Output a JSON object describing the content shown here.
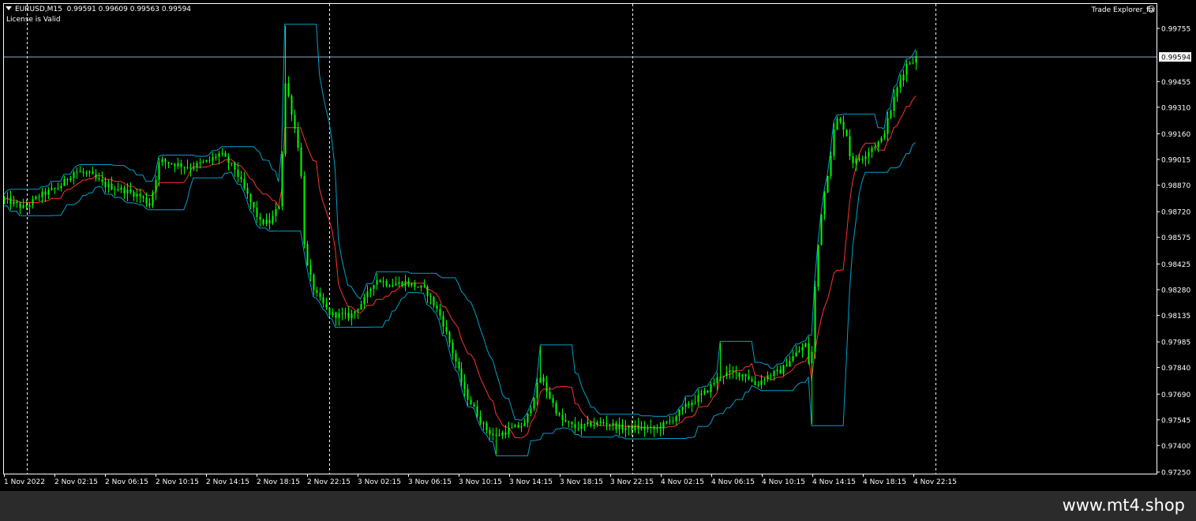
{
  "header": {
    "symbol": "EURUSD,M15",
    "ohlc": "0.99591 0.99609 0.99563 0.99594",
    "license": "License is Valid",
    "indicator": "Trade Explorer_fix",
    "watermark": "www.mt4.shop"
  },
  "colors": {
    "background": "#000000",
    "frame": "#ffffff",
    "candle": "#00ff00",
    "grid": "#ffffff",
    "bid_line": "#8fa8c8",
    "band_upper": "#00a0c8",
    "band_mid": "#ff3030",
    "band_lower": "#00a0c8"
  },
  "chart_data": {
    "type": "candlestick",
    "symbol": "EURUSD",
    "timeframe": "M15",
    "current_price": "0.99594",
    "ylim": [
      0.9725,
      0.9983
    ],
    "y_ticks": [
      "0.99755",
      "0.99594",
      "0.99455",
      "0.99310",
      "0.99160",
      "0.99015",
      "0.98870",
      "0.98720",
      "0.98575",
      "0.98425",
      "0.98280",
      "0.98135",
      "0.97985",
      "0.97840",
      "0.97690",
      "0.97545",
      "0.97400",
      "0.97250"
    ],
    "x_ticks": [
      "1 Nov 2022",
      "2 Nov 02:15",
      "2 Nov 06:15",
      "2 Nov 10:15",
      "2 Nov 14:15",
      "2 Nov 18:15",
      "2 Nov 22:15",
      "3 Nov 02:15",
      "3 Nov 06:15",
      "3 Nov 10:15",
      "3 Nov 14:15",
      "3 Nov 18:15",
      "3 Nov 22:15",
      "4 Nov 02:15",
      "4 Nov 06:15",
      "4 Nov 10:15",
      "4 Nov 14:15",
      "4 Nov 18:15",
      "4 Nov 22:15"
    ],
    "day_separators": [
      "2 Nov 00:00",
      "3 Nov 00:00",
      "4 Nov 00:00",
      "5 Nov 00:00"
    ],
    "close_path": [
      [
        0,
        0.9879
      ],
      [
        4,
        0.9874
      ],
      [
        7,
        0.9881
      ],
      [
        11,
        0.9886
      ],
      [
        14,
        0.9895
      ],
      [
        17,
        0.9893
      ],
      [
        20,
        0.9887
      ],
      [
        24,
        0.9884
      ],
      [
        27,
        0.9881
      ],
      [
        29,
        0.9876
      ],
      [
        31,
        0.9901
      ],
      [
        34,
        0.9899
      ],
      [
        37,
        0.9897
      ],
      [
        41,
        0.9901
      ],
      [
        43,
        0.9905
      ],
      [
        46,
        0.9896
      ],
      [
        49,
        0.9878
      ],
      [
        51,
        0.9866
      ],
      [
        53,
        0.9866
      ],
      [
        55,
        0.9877
      ],
      [
        56,
        0.9945
      ],
      [
        57,
        0.9933
      ],
      [
        59,
        0.9903
      ],
      [
        60,
        0.9845
      ],
      [
        62,
        0.9826
      ],
      [
        65,
        0.9814
      ],
      [
        69,
        0.9813
      ],
      [
        72,
        0.9823
      ],
      [
        74,
        0.9834
      ],
      [
        77,
        0.9831
      ],
      [
        80,
        0.9832
      ],
      [
        84,
        0.9828
      ],
      [
        87,
        0.9813
      ],
      [
        90,
        0.9788
      ],
      [
        92,
        0.977
      ],
      [
        94,
        0.976
      ],
      [
        96,
        0.975
      ],
      [
        98,
        0.9745
      ],
      [
        101,
        0.9749
      ],
      [
        104,
        0.9752
      ],
      [
        107,
        0.9779
      ],
      [
        109,
        0.9767
      ],
      [
        111,
        0.9755
      ],
      [
        114,
        0.975
      ],
      [
        117,
        0.9752
      ],
      [
        120,
        0.9753
      ],
      [
        123,
        0.975
      ],
      [
        127,
        0.975
      ],
      [
        130,
        0.9749
      ],
      [
        133,
        0.9754
      ],
      [
        136,
        0.9762
      ],
      [
        140,
        0.977
      ],
      [
        143,
        0.978
      ],
      [
        145,
        0.9781
      ],
      [
        148,
        0.978
      ],
      [
        150,
        0.9774
      ],
      [
        152,
        0.9779
      ],
      [
        155,
        0.9782
      ],
      [
        157,
        0.9789
      ],
      [
        160,
        0.9797
      ],
      [
        161,
        0.978
      ],
      [
        162,
        0.9838
      ],
      [
        163,
        0.987
      ],
      [
        165,
        0.9905
      ],
      [
        166,
        0.9925
      ],
      [
        168,
        0.9918
      ],
      [
        169,
        0.99
      ],
      [
        171,
        0.9902
      ],
      [
        173,
        0.9908
      ],
      [
        175,
        0.9912
      ],
      [
        176,
        0.992
      ],
      [
        178,
        0.994
      ],
      [
        180,
        0.9955
      ],
      [
        182,
        0.9959
      ]
    ]
  }
}
